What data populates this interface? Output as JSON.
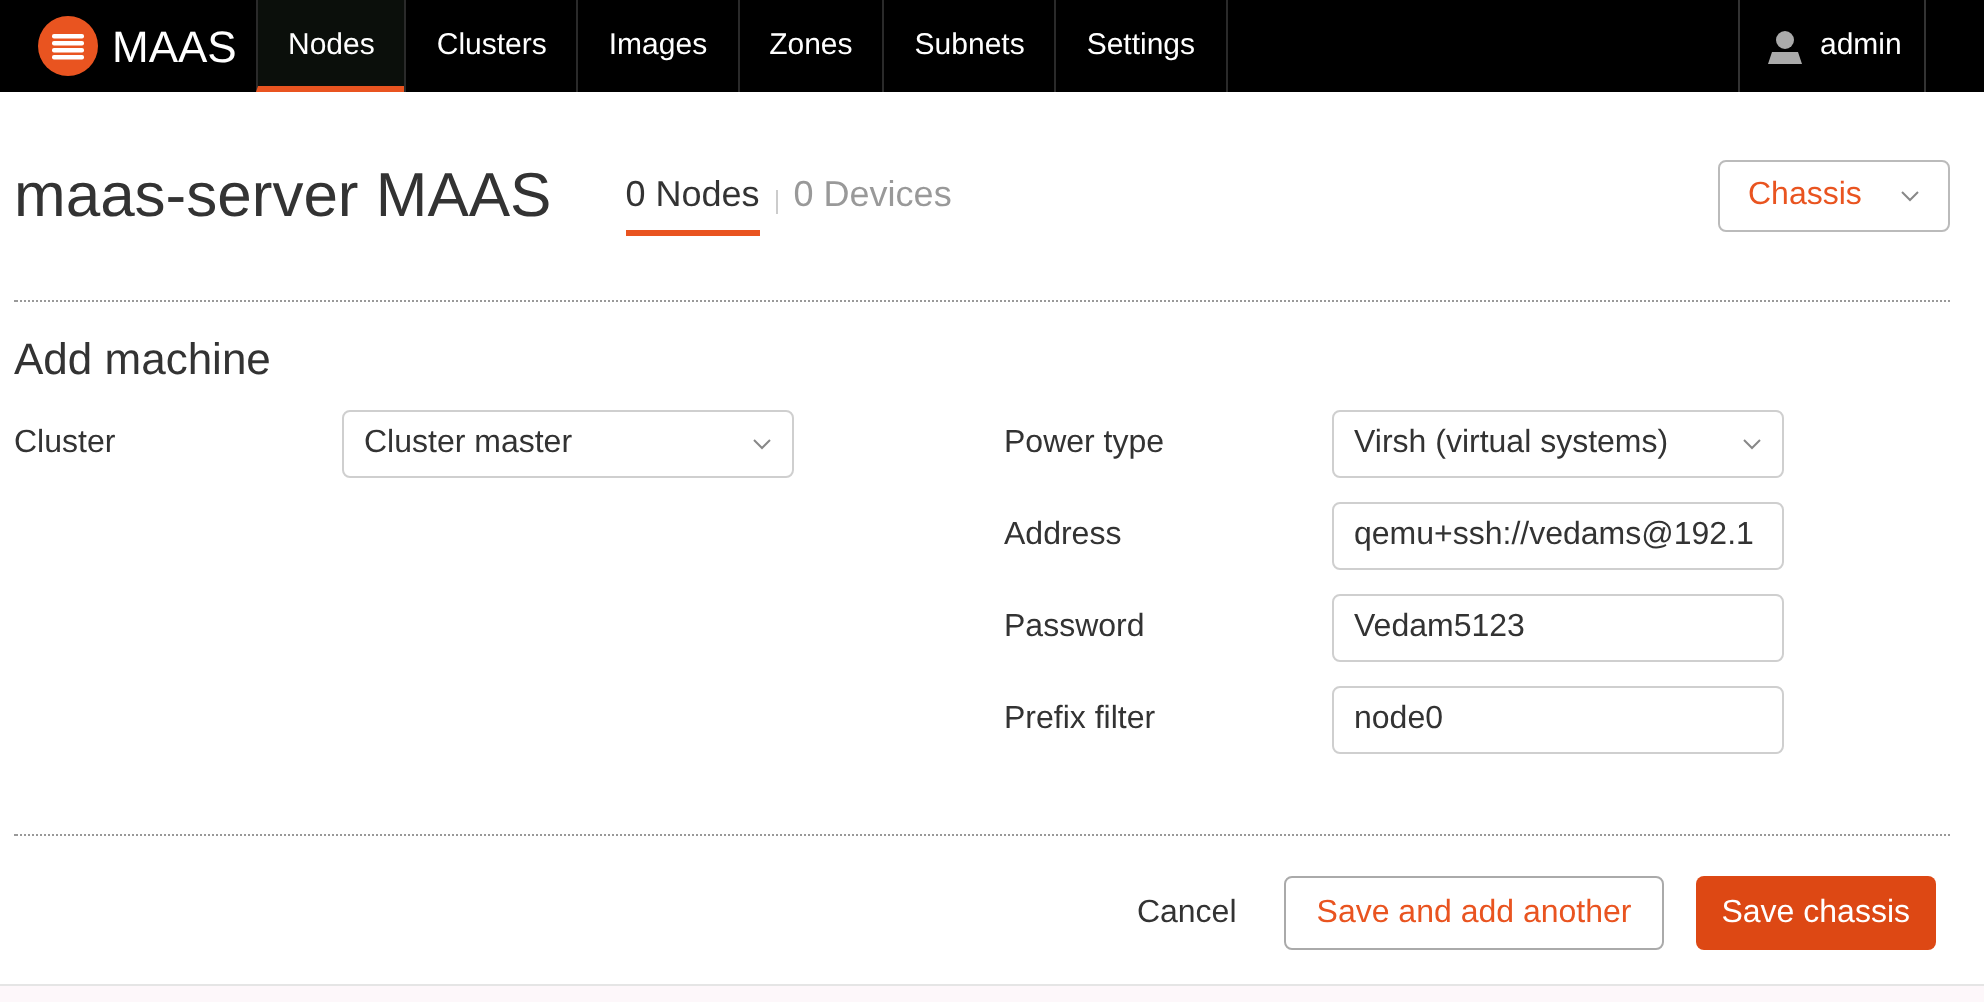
{
  "brand": "MAAS",
  "nav": [
    {
      "label": "Nodes",
      "selected": true
    },
    {
      "label": "Clusters",
      "selected": false
    },
    {
      "label": "Images",
      "selected": false
    },
    {
      "label": "Zones",
      "selected": false
    },
    {
      "label": "Subnets",
      "selected": false
    },
    {
      "label": "Settings",
      "selected": false
    }
  ],
  "user": "admin",
  "title": "maas-server MAAS",
  "tabs": [
    {
      "label": "0 Nodes",
      "selected": true
    },
    {
      "label": "0 Devices",
      "selected": false
    }
  ],
  "add_menu": {
    "value": "Chassis"
  },
  "form": {
    "title": "Add machine",
    "left": [
      {
        "kind": "select",
        "label": "Cluster",
        "value": "Cluster master"
      }
    ],
    "right": [
      {
        "kind": "select",
        "label": "Power type",
        "value": "Virsh (virtual systems)"
      },
      {
        "kind": "input",
        "label": "Address",
        "value": "qemu+ssh://vedams@192.1"
      },
      {
        "kind": "input",
        "label": "Password",
        "value": "Vedam5123"
      },
      {
        "kind": "input",
        "label": "Prefix filter",
        "value": "node0"
      }
    ]
  },
  "actions": {
    "cancel": "Cancel",
    "secondary": "Save and add another",
    "primary": "Save chassis"
  }
}
